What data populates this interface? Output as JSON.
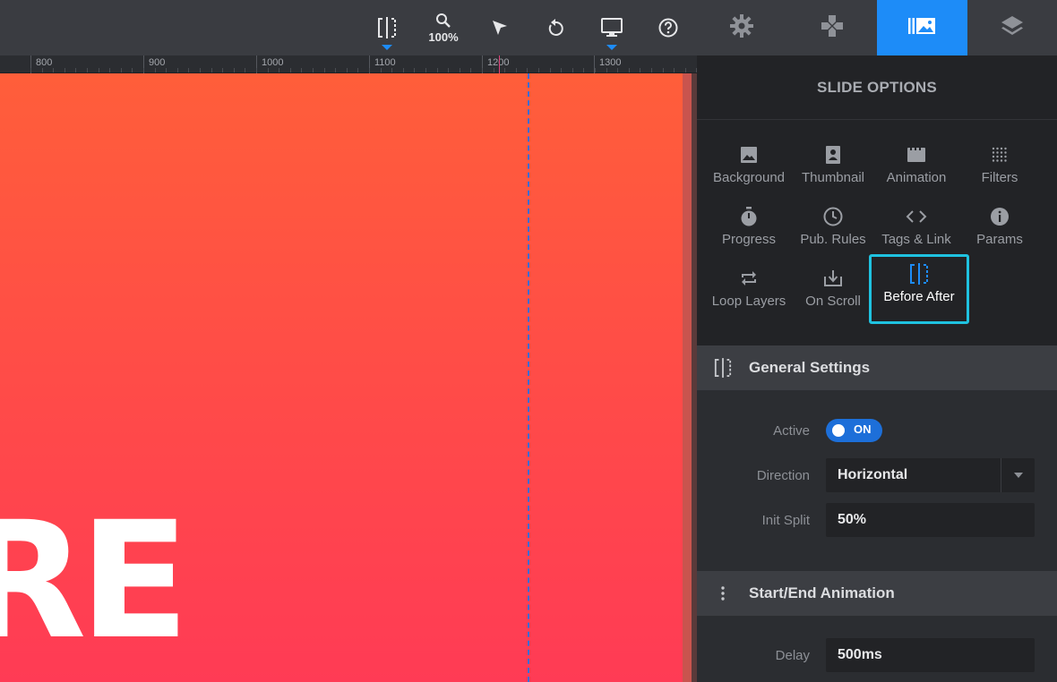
{
  "toolbar": {
    "zoom_label": "100%",
    "icons": [
      "before-after-icon",
      "zoom-icon",
      "pointer-icon",
      "undo-icon",
      "desktop-icon",
      "help-icon"
    ]
  },
  "ruler": {
    "labels": [
      "800",
      "900",
      "1000",
      "1100",
      "1200",
      "1300"
    ]
  },
  "canvas": {
    "slide_text": "RE"
  },
  "right_tabs": {
    "items": [
      {
        "name": "settings",
        "icon": "gear-icon",
        "active": false
      },
      {
        "name": "navigation",
        "icon": "gamepad-icon",
        "active": false
      },
      {
        "name": "slides",
        "icon": "slides-icon",
        "active": true
      },
      {
        "name": "layers",
        "icon": "layers-icon",
        "active": false
      }
    ]
  },
  "panel": {
    "title": "SLIDE OPTIONS",
    "options": [
      {
        "label": "Background",
        "icon": "image-icon"
      },
      {
        "label": "Thumbnail",
        "icon": "portrait-icon"
      },
      {
        "label": "Animation",
        "icon": "film-icon"
      },
      {
        "label": "Filters",
        "icon": "dots-grid-icon"
      },
      {
        "label": "Progress",
        "icon": "stopwatch-icon"
      },
      {
        "label": "Pub. Rules",
        "icon": "clock-icon"
      },
      {
        "label": "Tags & Link",
        "icon": "code-icon"
      },
      {
        "label": "Params",
        "icon": "info-icon"
      },
      {
        "label": "Loop Layers",
        "icon": "loop-icon"
      },
      {
        "label": "On Scroll",
        "icon": "download-box-icon"
      },
      {
        "label": "Before After",
        "icon": "before-after-icon",
        "selected": true
      }
    ],
    "general": {
      "title": "General Settings",
      "active_label": "Active",
      "active_value": "ON",
      "direction_label": "Direction",
      "direction_value": "Horizontal",
      "init_split_label": "Init Split",
      "init_split_value": "50%"
    },
    "animation": {
      "title": "Start/End Animation",
      "delay_label": "Delay",
      "delay_value": "500ms"
    }
  },
  "colors": {
    "accent": "#1d8cf8",
    "highlight": "#1fc2e0",
    "slide_top": "#ff5e3a",
    "slide_bottom": "#ff3b55"
  }
}
